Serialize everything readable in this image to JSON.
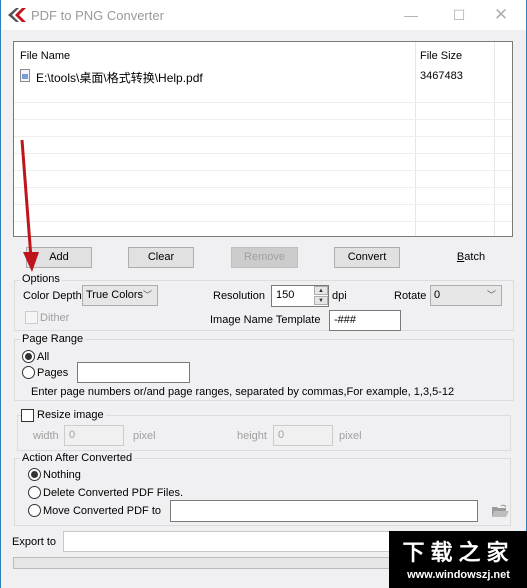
{
  "window": {
    "title": "PDF to PNG Converter",
    "controls": {
      "minimize": "—",
      "maximize": "☐",
      "close": "✕"
    }
  },
  "filelist": {
    "columns": [
      "File Name",
      "File Size"
    ],
    "rows": [
      {
        "name": "E:\\tools\\桌面\\格式转换\\Help.pdf",
        "size": "3467483",
        "icon": "pdf-file-icon"
      }
    ]
  },
  "toolbar": {
    "add": "Add",
    "clear": "Clear",
    "remove": "Remove",
    "convert": "Convert",
    "batch_prefix": "B",
    "batch_rest": "atch"
  },
  "options": {
    "title": "Options",
    "color_depth_label": "Color Depth",
    "color_depth_value": "True Colors",
    "resolution_label": "Resolution",
    "resolution_value": "150",
    "resolution_unit": "dpi",
    "rotate_label": "Rotate",
    "rotate_value": "0",
    "dither_label": "Dither",
    "dither_checked": false,
    "template_label": "Image Name Template",
    "template_value": "-###"
  },
  "page_range": {
    "title": "Page Range",
    "all_label": "All",
    "pages_label": "Pages",
    "pages_value": "",
    "selected": "All",
    "hint": "Enter page numbers or/and page ranges, separated by commas,For example, 1,3,5-12"
  },
  "resize": {
    "title": "Resize image",
    "checked": false,
    "width_label": "width",
    "width_value": "0",
    "height_label": "height",
    "height_value": "0",
    "unit": "pixel"
  },
  "action_after": {
    "title": "Action After Converted",
    "nothing": "Nothing",
    "delete": "Delete Converted PDF Files.",
    "move": "Move Converted PDF to",
    "move_path": "",
    "selected": "Nothing"
  },
  "export": {
    "label": "Export to",
    "value": ""
  },
  "progress": {
    "percent": 0
  },
  "watermark": {
    "cn": "下载之家",
    "url": "www.windowszj.net"
  }
}
